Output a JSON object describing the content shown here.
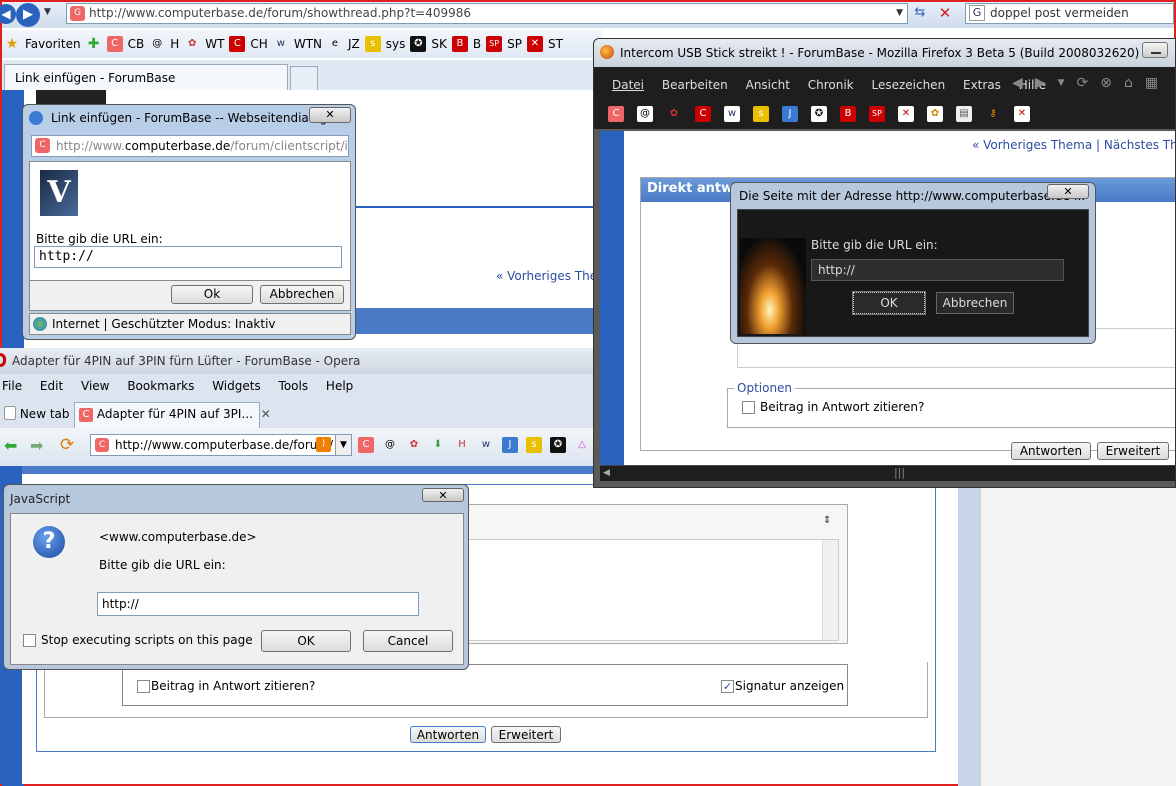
{
  "ie": {
    "url": "http://www.computerbase.de/forum/showthread.php?t=409986",
    "search": "doppel post vermeiden",
    "favorites_label": "Favoriten",
    "links": [
      "CB",
      "H",
      "WT",
      "CH",
      "WTN",
      "JZ",
      "sys",
      "SK",
      "B",
      "SP",
      "ST"
    ],
    "tab": "Link einfügen - ForumBase",
    "prev_thread": "Vorheriges The"
  },
  "ie_dialog": {
    "title": "Link einfügen - ForumBase -- Webseitendialog",
    "address_pre": "http://www.",
    "address_domain": "computerbase.de",
    "address_post": "/forum/clientscript/ieprc",
    "prompt": "Bitte gib die URL ein:",
    "value": "http://",
    "ok": "Ok",
    "cancel": "Abbrechen",
    "status": "Internet | Geschützter Modus: Inaktiv",
    "close": "✕"
  },
  "opera": {
    "title": "Adapter für 4PIN auf 3PIN fürn Lüfter - ForumBase - Opera",
    "menu": [
      "File",
      "Edit",
      "View",
      "Bookmarks",
      "Widgets",
      "Tools",
      "Help"
    ],
    "tab_new": "New tab",
    "tab_active": "Adapter für 4PIN auf 3PI...",
    "tab_close": "✕",
    "url": "http://www.computerbase.de/forum/",
    "quote_label": "Beitrag in Antwort zitieren?",
    "signature_label": "Signatur anzeigen",
    "reply_btn": "Antworten",
    "advanced_btn": "Erweitert"
  },
  "js_dialog": {
    "title": "JavaScript",
    "site": "<www.computerbase.de>",
    "prompt": "Bitte gib die URL ein:",
    "value": "http://",
    "stop_label": "Stop executing scripts on this page",
    "ok": "OK",
    "cancel": "Cancel",
    "close": "✕"
  },
  "firefox": {
    "title": "Intercom USB Stick streikt ! - ForumBase - Mozilla Firefox 3 Beta 5 (Build 2008032620)",
    "menu": [
      "Datei",
      "Bearbeiten",
      "Ansicht",
      "Chronik",
      "Lesezeichen",
      "Extras",
      "Hilfe"
    ],
    "nav": "« Vorheriges Thema | Nächstes The",
    "panel_title": "Direkt antwo",
    "options_legend": "Optionen",
    "quote_label": "Beitrag in Antwort zitieren?",
    "btn_partial1": "Antworten",
    "btn_partial2": "Erweitert",
    "scroll_grip": "|||"
  },
  "ff_dialog": {
    "title": "Die Seite mit der Adresse http://www.computerbase.de ...",
    "prompt": "Bitte gib die URL ein:",
    "value": "http://",
    "ok": "OK",
    "cancel": "Abbrechen",
    "close": "✕"
  }
}
